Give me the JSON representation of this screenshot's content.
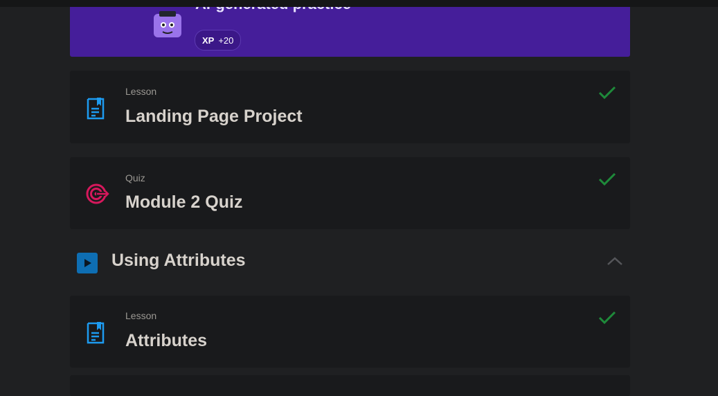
{
  "promo": {
    "title": "AI-generated practice",
    "xp_label": "XP",
    "xp_value": "+20"
  },
  "items": [
    {
      "kind": "Lesson",
      "title": "Landing Page Project",
      "icon": "lesson-book-icon",
      "completed": true
    },
    {
      "kind": "Quiz",
      "title": "Module 2 Quiz",
      "icon": "target-icon",
      "completed": true
    }
  ],
  "section": {
    "title": "Using Attributes",
    "icon": "play-icon",
    "expanded": true
  },
  "section_items": [
    {
      "kind": "Lesson",
      "title": "Attributes",
      "icon": "lesson-book-icon",
      "completed": true
    }
  ],
  "colors": {
    "background": "#1f2022",
    "card": "#191a1c",
    "promo": "#451e9a",
    "check": "#1e8a3a",
    "lesson_icon": "#1d9bf0",
    "quiz_icon": "#d6185c",
    "section_icon": "#0e6eb3"
  }
}
